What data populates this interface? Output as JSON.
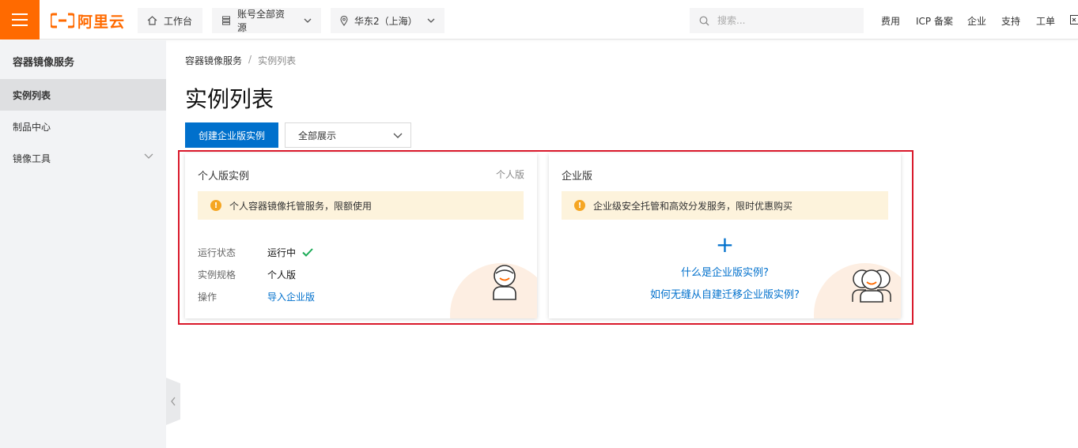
{
  "header": {
    "logo_text": "阿里云",
    "workbench": "工作台",
    "resources": "账号全部资源",
    "region": "华东2（上海）",
    "search_placeholder": "搜索...",
    "links": [
      "费用",
      "ICP 备案",
      "企业",
      "支持",
      "工单"
    ]
  },
  "sidebar": {
    "title": "容器镜像服务",
    "items": [
      {
        "label": "实例列表",
        "active": true
      },
      {
        "label": "制品中心",
        "active": false
      },
      {
        "label": "镜像工具",
        "active": false
      }
    ]
  },
  "breadcrumb": {
    "parent": "容器镜像服务",
    "separator": "/",
    "current": "实例列表"
  },
  "page": {
    "title": "实例列表",
    "create_button": "创建企业版实例",
    "filter_value": "全部展示"
  },
  "personal_card": {
    "title": "个人版实例",
    "tag": "个人版",
    "notice": "个人容器镜像托管服务，限额使用",
    "rows": [
      {
        "label": "运行状态",
        "value": "运行中"
      },
      {
        "label": "实例规格",
        "value": "个人版"
      },
      {
        "label": "操作",
        "value": "导入企业版"
      }
    ]
  },
  "enterprise_card": {
    "title": "企业版",
    "notice": "企业级安全托管和高效分发服务，限时优惠购买",
    "plus": "+",
    "link1": "什么是企业版实例?",
    "link2": "如何无缝从自建迁移企业版实例?"
  },
  "colors": {
    "brand": "#ff6a00",
    "primary": "#0070cc",
    "highlight": "#d9182a",
    "notice_bg": "#fdf3dc",
    "success": "#1aaa55"
  }
}
